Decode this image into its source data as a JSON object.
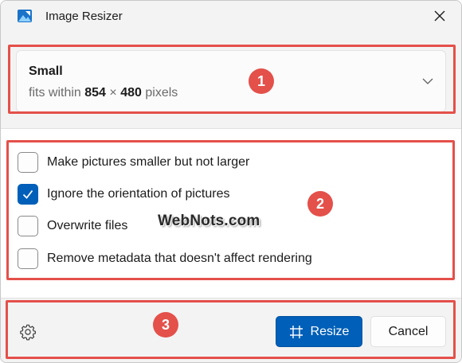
{
  "window": {
    "title": "Image Resizer"
  },
  "preset": {
    "name": "Small",
    "desc_prefix": "fits within",
    "width": "854",
    "times": "×",
    "height": "480",
    "unit": "pixels"
  },
  "options": [
    {
      "label": "Make pictures smaller but not larger",
      "checked": false
    },
    {
      "label": "Ignore the orientation of pictures",
      "checked": true
    },
    {
      "label": "Overwrite files",
      "checked": false
    },
    {
      "label": "Remove metadata that doesn't affect rendering",
      "checked": false
    }
  ],
  "footer": {
    "resize_label": "Resize",
    "cancel_label": "Cancel"
  },
  "watermark": "WebNots.com",
  "annotations": [
    "1",
    "2",
    "3"
  ],
  "colors": {
    "accent": "#005fb8",
    "annotation": "#e4504a"
  },
  "icons": {
    "app": "image-resizer-icon",
    "close": "close-icon",
    "dropdown": "chevron-down-icon",
    "check": "checkmark-icon",
    "settings": "gear-icon",
    "resize": "resize-frame-icon"
  }
}
